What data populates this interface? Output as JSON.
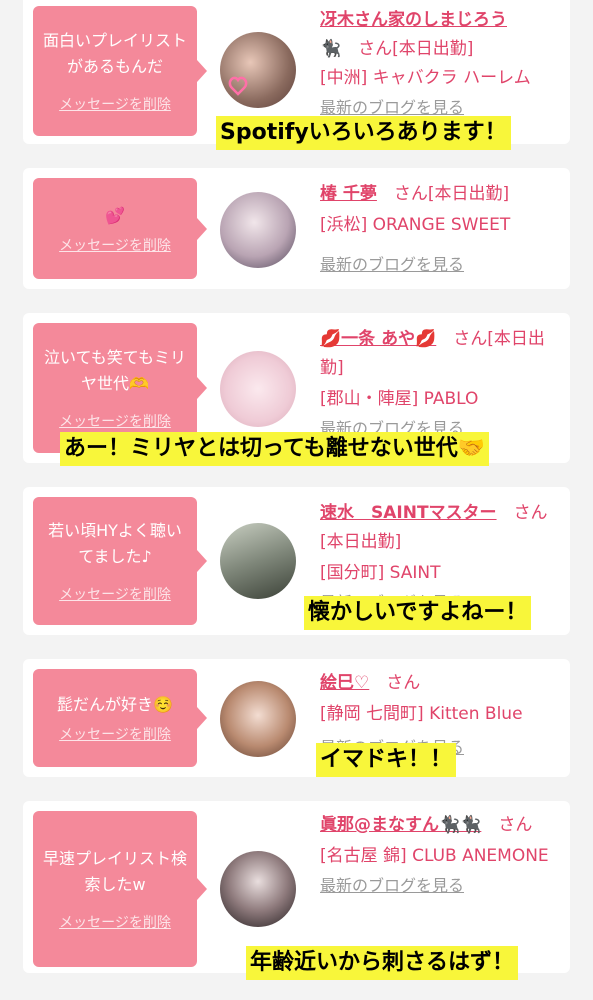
{
  "delete_label": "メッセージを削除",
  "san": "さん",
  "blog_label": "最新のブログを見る",
  "cards": [
    {
      "message": "面白いプレイリストがあるもんだ",
      "name": "冴木さん家のしまじろう",
      "name_emoji": "🐈‍⬛",
      "status": "[本日出勤]",
      "shop": "[中洲] キャバクラ ハーレム",
      "caption": "Spotifyいろいろあります！"
    },
    {
      "message": "💕",
      "name": "椿 千夢",
      "status": "[本日出勤]",
      "shop": "[浜松] ORANGE SWEET"
    },
    {
      "message": "泣いても笑てもミリヤ世代🫶",
      "name": "💋一条 あや💋",
      "status": "[本日出勤]",
      "shop": "[郡山・陣屋] PABLO",
      "caption": "あー！ミリヤとは切っても離せない世代🤝"
    },
    {
      "message": "若い頃HYよく聴いてました♪",
      "name": "速水　SAINTマスター",
      "status": "[本日出勤]",
      "shop": "[国分町] SAINT",
      "caption": "懐かしいですよねー！"
    },
    {
      "message": "髭だんが好き☺️",
      "name": "絵巳♡",
      "shop": "[静岡 七間町] Kitten Blue",
      "caption": "イマドキ！！"
    },
    {
      "message": "早速プレイリスト検索したw",
      "name": "眞那@まなすん🐈‍⬛🐈‍⬛",
      "shop": "[名古屋 錦] CLUB ANEMONE",
      "caption": "年齢近いから刺さるはず！"
    }
  ],
  "colors": {
    "bubble": "#f4899a",
    "accent": "#e0446a",
    "highlight": "#f8f63a"
  }
}
